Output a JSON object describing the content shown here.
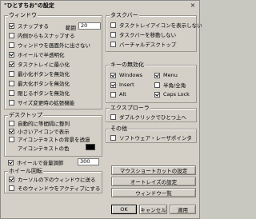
{
  "window": {
    "title": "\"ひとすちお\"の設定",
    "close_glyph": "×"
  },
  "window_group": {
    "title": "ウィンドウ",
    "snap": {
      "label": "スナップする",
      "checked": true,
      "range_label": "範囲",
      "range_value": "20"
    },
    "items": [
      {
        "label": "内側からもスナップする",
        "checked": false
      },
      {
        "label": "ウィンドウを画面外に出さない",
        "checked": false
      },
      {
        "label": "ホイールで半透明化",
        "checked": true
      },
      {
        "label": "タスクトレイに最小化",
        "checked": true
      },
      {
        "label": "最小化ボタンを無効化",
        "checked": false
      },
      {
        "label": "最大化ボタンを無効化",
        "checked": false
      },
      {
        "label": "閉じるボタンを無効化",
        "checked": false
      },
      {
        "label": "サイズ変更時の拡張機能",
        "checked": false
      }
    ]
  },
  "desktop_group": {
    "title": "デスクトップ",
    "items": [
      {
        "label": "自動的に等間隔に整列",
        "checked": false
      },
      {
        "label": "小さいアイコンで表示",
        "checked": true
      },
      {
        "label": "アイコンテキストの背景を透過",
        "checked": false
      }
    ],
    "text_color_label": "アイコンテキストの色",
    "text_color": "#000000",
    "volume": {
      "label": "ホイールで音量調節",
      "checked": true,
      "value": "300"
    }
  },
  "wheel_group": {
    "title": "ホイール回転",
    "items": [
      {
        "label": "カーソルの下のウィンドウに送る",
        "checked": true
      },
      {
        "label": "そのウィンドウをアクティブにする",
        "checked": false
      }
    ]
  },
  "taskbar_group": {
    "title": "タスクバー",
    "items": [
      {
        "label": "タスクトレイアイコンを表示しない",
        "checked": false
      },
      {
        "label": "タスクバーを移動しない",
        "checked": false
      },
      {
        "label": "バーチャルデスクトップ",
        "checked": false
      }
    ]
  },
  "keys_group": {
    "title": "キーの無効化",
    "items": [
      {
        "label": "Windows",
        "checked": true
      },
      {
        "label": "Menu",
        "checked": true
      },
      {
        "label": "Insert",
        "checked": true
      },
      {
        "label": "半角/全角",
        "checked": false
      },
      {
        "label": "Alt",
        "checked": false
      },
      {
        "label": "Caps Lock",
        "checked": true
      }
    ]
  },
  "explorer_group": {
    "title": "エクスプローラ",
    "items": [
      {
        "label": "ダブルクリックでひとつ上へ",
        "checked": false
      }
    ]
  },
  "other_group": {
    "title": "その他",
    "items": [
      {
        "label": "ソフトウェア・レーザポインタ",
        "checked": false
      }
    ]
  },
  "buttons": {
    "mouse_shortcut": "マウスショートカットの設定",
    "autoraise": "オートレイズの設定",
    "window_list": "ウィンドウ一覧",
    "ok": "OK",
    "cancel": "キャンセル",
    "apply": "適用"
  }
}
